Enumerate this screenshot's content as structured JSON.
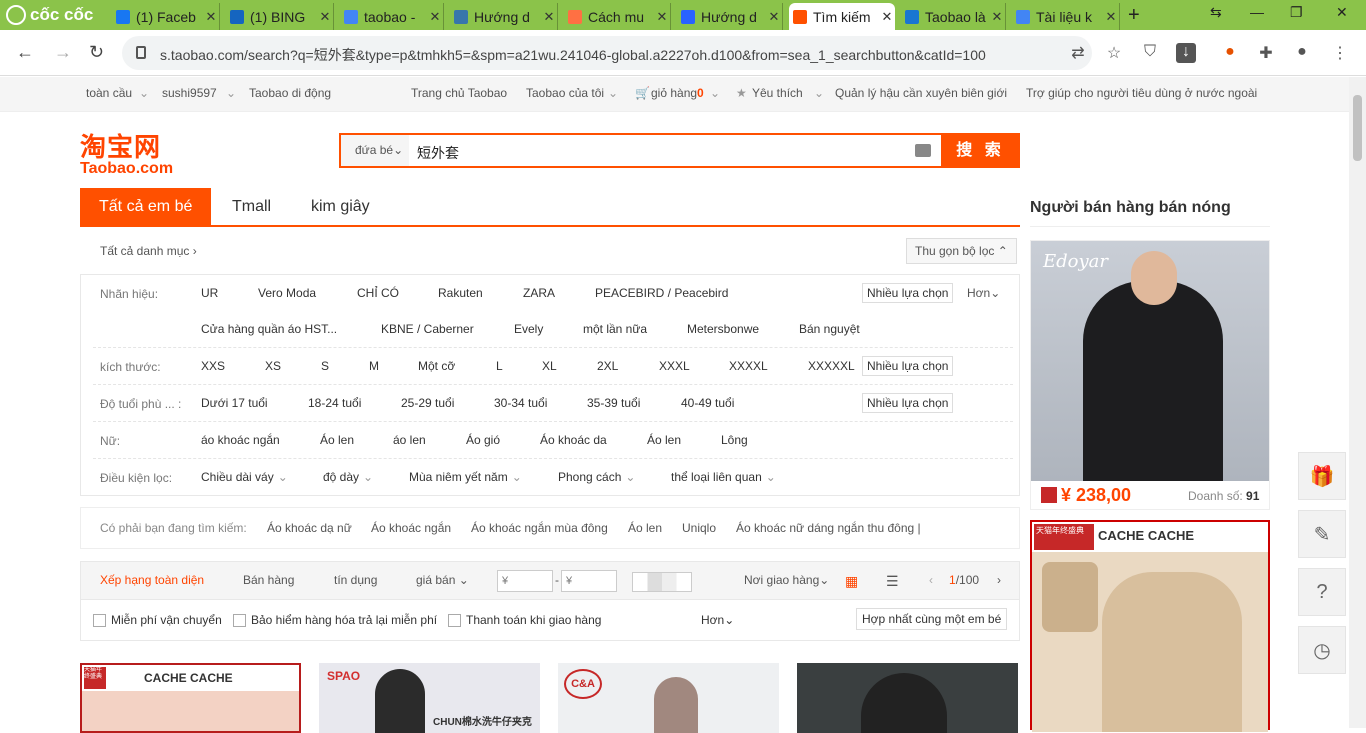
{
  "browser": {
    "brand": "cốc cốc",
    "tabs": [
      {
        "title": "(1) Faceb",
        "icon": "facebook-icon",
        "color": "#1877f2"
      },
      {
        "title": "(1) BING",
        "icon": "bingo-icon",
        "color": "#1565c0"
      },
      {
        "title": "taobao -",
        "icon": "google-icon",
        "color": "#4285f4"
      },
      {
        "title": "Hướng d",
        "icon": "python-icon",
        "color": "#3776ab"
      },
      {
        "title": "Cách mu",
        "icon": "c-icon",
        "color": "#ff7043"
      },
      {
        "title": "Hướng d",
        "icon": "basket-icon",
        "color": "#2962ff"
      },
      {
        "title": "Tìm kiếm",
        "icon": "taobao-icon",
        "color": "#ff5000"
      },
      {
        "title": "Taobao là",
        "icon": "qn-icon",
        "color": "#1976d2"
      },
      {
        "title": "Tài liệu k",
        "icon": "docs-icon",
        "color": "#4285f4"
      }
    ],
    "url": "s.taobao.com/search?q=短外套&type=p&tmhkh5=&spm=a21wu.241046-global.a2227oh.d100&from=sea_1_searchbutton&catId=100"
  },
  "sitebar": {
    "left": [
      "toàn cầu",
      "sushi9597",
      "Taobao di động"
    ],
    "home": "Trang chủ Taobao",
    "mytaobao": "Taobao của tôi",
    "cart": "giỏ hàng",
    "cart_count": "0",
    "fav": "Yêu thích",
    "manage": "Quản lý hậu cần xuyên biên giới",
    "help": "Trợ giúp cho người tiêu dùng ở nước ngoài"
  },
  "logo": {
    "cn": "淘宝网",
    "en": "Taobao.com"
  },
  "search": {
    "category": "đứa bé",
    "query": "短外套",
    "button": "搜 索"
  },
  "tabs": [
    "Tất cả em bé",
    "Tmall",
    "kim giây"
  ],
  "crumb": "Tất cả danh mục",
  "collapse": "Thu gọn bộ lọc",
  "filters": {
    "brand_label": "Nhãn hiệu:",
    "brands_row1": [
      "UR",
      "Vero Moda",
      "CHỈ CÓ",
      "Rakuten",
      "ZARA",
      "PEACEBIRD / Peacebird"
    ],
    "brands_row2": [
      "Cửa hàng quần áo HST...",
      "KBNE / Caberner",
      "Evely",
      "một lần nữa",
      "Metersbonwe",
      "Bán nguyệt"
    ],
    "more_choice": "Nhiều lựa chọn",
    "more": "Hơn",
    "size_label": "kích thước:",
    "sizes": [
      "XXS",
      "XS",
      "S",
      "M",
      "Một cỡ",
      "L",
      "XL",
      "2XL",
      "XXXL",
      "XXXXL",
      "XXXXXL"
    ],
    "age_label": "Độ tuổi phù ... :",
    "ages": [
      "Dưới 17 tuổi",
      "18-24 tuổi",
      "25-29 tuổi",
      "30-34 tuổi",
      "35-39 tuổi",
      "40-49 tuổi"
    ],
    "female_label": "Nữ:",
    "female": [
      "áo khoác ngắn",
      "Áo len",
      "áo len",
      "Áo gió",
      "Áo khoác da",
      "Áo len",
      "Lông"
    ],
    "cond_label": "Điều kiện lọc:",
    "conditions": [
      "Chiều dài váy",
      "độ dày",
      "Mùa niêm yết năm",
      "Phong cách",
      "thể loại liên quan"
    ]
  },
  "suggest": {
    "label": "Có phải bạn đang tìm kiếm:",
    "items": [
      "Áo khoác dạ nữ",
      "Áo khoác ngắn",
      "Áo khoác ngắn mùa đông",
      "Áo len",
      "Uniqlo",
      "Áo khoác nữ dáng ngắn thu đông |"
    ]
  },
  "sort": {
    "items": [
      "Xếp hạng toàn diện",
      "Bán hàng",
      "tín dụng",
      "giá bán"
    ],
    "price_from": "¥",
    "price_to": "¥",
    "dash": "-",
    "ship_from": "Nơi giao hàng",
    "page": "1",
    "total": "/100",
    "checks": [
      "Miễn phí vận chuyển",
      "Bảo hiểm hàng hóa trả lại miễn phí",
      "Thanh toán khi giao hàng"
    ],
    "more": "Hơn",
    "merge": "Hợp nhất cùng một em bé"
  },
  "products": [
    {
      "brand": "CACHE CACHE",
      "badge": "天猫年终盛典",
      "bg": "#f3d2c4"
    },
    {
      "brand": "SPAO",
      "badge": "CHUN棉水洗牛仔夹克",
      "bg": "#e8e8ee"
    },
    {
      "brand": "C&A",
      "badge": "",
      "bg": "#eef0f2"
    },
    {
      "brand": "",
      "badge": "",
      "bg": "#3a3f40"
    }
  ],
  "hot": {
    "title": "Người bán hàng bán nóng",
    "item1": {
      "brand": "Edoyar",
      "price": "¥ 238,00",
      "sales_label": "Doanh số:",
      "sales": "91"
    },
    "item2": {
      "brand": "CACHE CACHE",
      "badge": "天猫年终盛典"
    }
  },
  "side_tools": [
    "gift-icon",
    "edit-icon",
    "help-icon",
    "history-icon"
  ],
  "colors": {
    "accent": "#ff5000",
    "browser": "#8bc34a"
  }
}
